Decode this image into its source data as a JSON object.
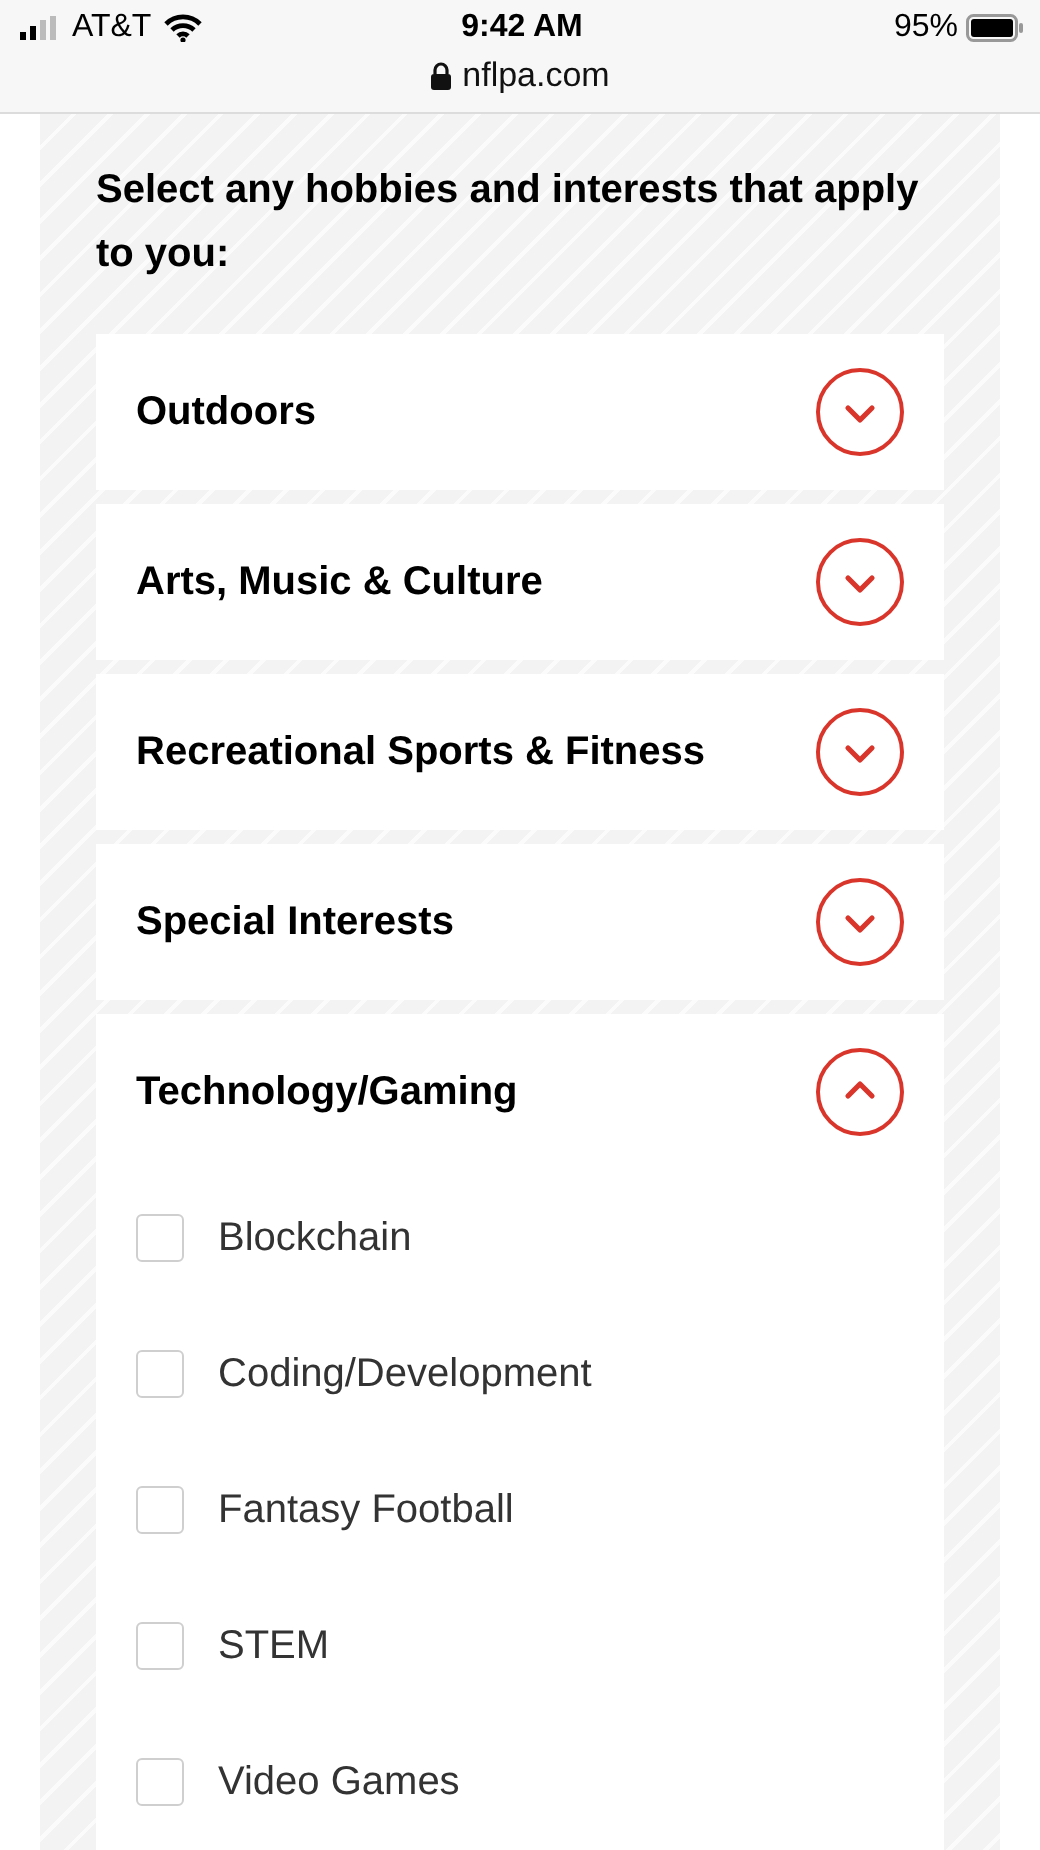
{
  "status_bar": {
    "carrier": "AT&T",
    "time": "9:42 AM",
    "battery": "95%"
  },
  "address_bar": {
    "url": "nflpa.com"
  },
  "prompt": "Select any hobbies and interests that apply to you:",
  "sections": [
    {
      "title": "Outdoors",
      "expanded": false
    },
    {
      "title": "Arts, Music & Culture",
      "expanded": false
    },
    {
      "title": "Recreational Sports & Fitness",
      "expanded": false
    },
    {
      "title": "Special Interests",
      "expanded": false
    },
    {
      "title": "Technology/Gaming",
      "expanded": true,
      "options": [
        {
          "label": "Blockchain",
          "checked": false
        },
        {
          "label": "Coding/Development",
          "checked": false
        },
        {
          "label": "Fantasy Football",
          "checked": false
        },
        {
          "label": "STEM",
          "checked": false
        },
        {
          "label": "Video Games",
          "checked": false
        }
      ]
    }
  ]
}
